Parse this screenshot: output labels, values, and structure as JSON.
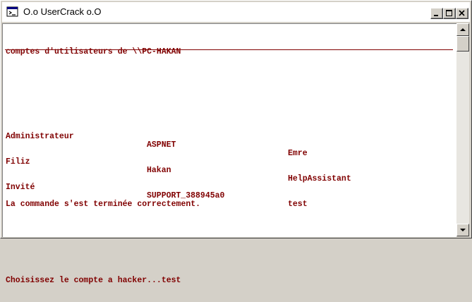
{
  "window": {
    "title": "O.o UserCrack o.O",
    "icon": "console-icon"
  },
  "title_buttons": {
    "minimize": "minimize-icon",
    "maximize": "maximize-icon",
    "close": "close-icon"
  },
  "console": {
    "header": "comptes d'utilisateurs de \\\\PC-HAKAN",
    "accounts": [
      [
        "Administrateur",
        "ASPNET",
        "Emre"
      ],
      [
        "Filiz",
        "Hakan",
        "HelpAssistant"
      ],
      [
        "Invité",
        "SUPPORT_388945a0",
        "test"
      ]
    ],
    "status": "La commande s'est terminée correctement.",
    "prompt": "Choisissez le compte a hacker...test"
  },
  "colors": {
    "text": "#800000",
    "background": "#ffffff",
    "chrome": "#d4d0c8"
  }
}
